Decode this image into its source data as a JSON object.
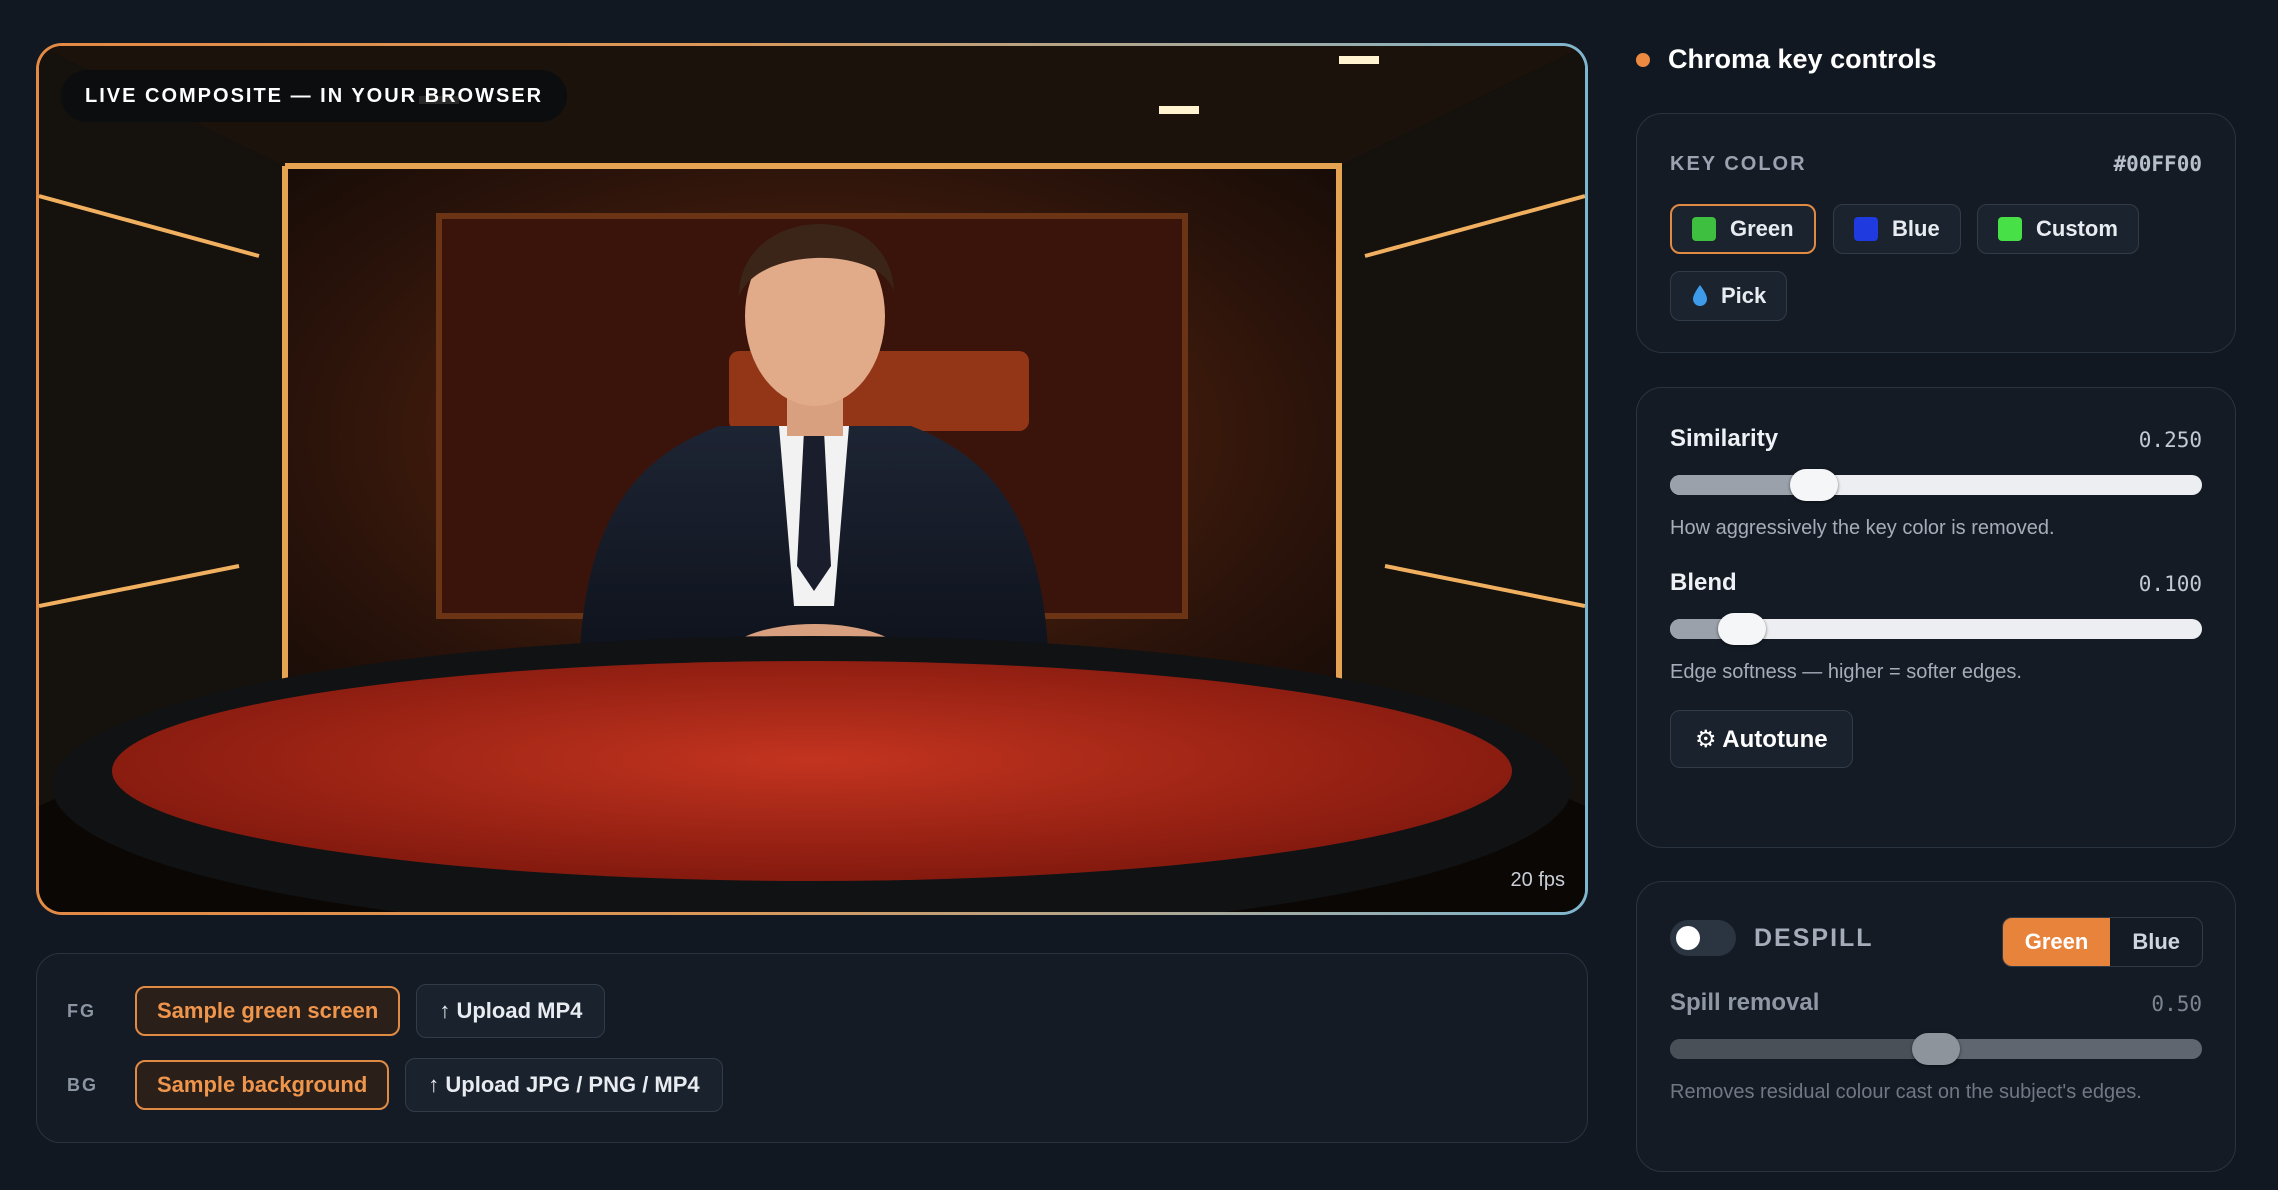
{
  "preview": {
    "badge": "LIVE COMPOSITE — IN YOUR BROWSER",
    "fps": "20 fps"
  },
  "sources": {
    "fg_label": "FG",
    "fg_sample": "Sample green screen",
    "fg_upload": "↑ Upload MP4",
    "bg_label": "BG",
    "bg_sample": "Sample background",
    "bg_upload": "↑ Upload JPG / PNG / MP4"
  },
  "controls": {
    "title": "Chroma key controls",
    "accent_color": "#EC8A42",
    "key_color": {
      "label": "KEY COLOR",
      "value": "#00FF00",
      "options": [
        {
          "label": "Green",
          "swatch": "#3FBF3F",
          "active": true
        },
        {
          "label": "Blue",
          "swatch": "#1F3BE0",
          "active": false
        },
        {
          "label": "Custom",
          "swatch": "#47E047",
          "active": false
        },
        {
          "label": "Pick",
          "icon": "droplet-icon",
          "active": false
        }
      ]
    },
    "similarity": {
      "label": "Similarity",
      "value": "0.250",
      "fraction": 0.27,
      "hint": "How aggressively the key color is removed."
    },
    "blend": {
      "label": "Blend",
      "value": "0.100",
      "fraction": 0.135,
      "hint": "Edge softness — higher = softer edges."
    },
    "autotune": "⚙ Autotune",
    "despill": {
      "label": "DESPILL",
      "enabled": false,
      "modes": [
        "Green",
        "Blue"
      ],
      "active_mode": "Green",
      "spill_label": "Spill removal",
      "spill_value": "0.50",
      "spill_fraction": 0.5,
      "hint": "Removes residual colour cast on the subject's edges."
    }
  }
}
